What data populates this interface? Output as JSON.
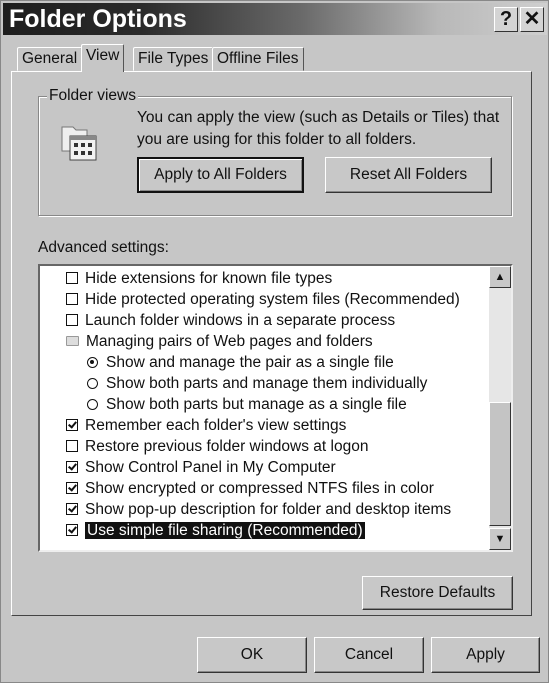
{
  "window": {
    "title": "Folder Options",
    "help_label": "?",
    "close_label": "✕"
  },
  "tabs": [
    {
      "label": "General",
      "active": false
    },
    {
      "label": "View",
      "active": true
    },
    {
      "label": "File Types",
      "active": false
    },
    {
      "label": "Offline Files",
      "active": false
    }
  ],
  "folder_views": {
    "label": "Folder views",
    "icon": "folder-views-icon",
    "description": "You can apply the view (such as Details or Tiles) that you are using for this folder to all folders.",
    "apply_label": "Apply to All Folders",
    "reset_label": "Reset All Folders"
  },
  "advanced": {
    "label": "Advanced settings:",
    "items": [
      {
        "type": "checkbox",
        "checked": false,
        "label": "Hide extensions for known file types"
      },
      {
        "type": "checkbox",
        "checked": false,
        "label": "Hide protected operating system files (Recommended)"
      },
      {
        "type": "checkbox",
        "checked": false,
        "label": "Launch folder windows in a separate process"
      },
      {
        "type": "folder",
        "label": "Managing pairs of Web pages and folders"
      },
      {
        "type": "radio",
        "checked": true,
        "label": "Show and manage the pair as a single file"
      },
      {
        "type": "radio",
        "checked": false,
        "label": "Show both parts and manage them individually"
      },
      {
        "type": "radio",
        "checked": false,
        "label": "Show both parts but manage as a single file"
      },
      {
        "type": "checkbox",
        "checked": true,
        "label": "Remember each folder's view settings"
      },
      {
        "type": "checkbox",
        "checked": false,
        "label": "Restore previous folder windows at logon"
      },
      {
        "type": "checkbox",
        "checked": true,
        "label": "Show Control Panel in My Computer"
      },
      {
        "type": "checkbox",
        "checked": true,
        "label": "Show encrypted or compressed NTFS files in color"
      },
      {
        "type": "checkbox",
        "checked": true,
        "label": "Show pop-up description for folder and desktop items"
      },
      {
        "type": "checkbox",
        "checked": true,
        "label": "Use simple file sharing (Recommended)",
        "selected": true
      }
    ],
    "scroll_up": "▲",
    "scroll_down": "▼"
  },
  "restore_defaults_label": "Restore Defaults",
  "footer": {
    "ok_label": "OK",
    "cancel_label": "Cancel",
    "apply_label": "Apply"
  }
}
